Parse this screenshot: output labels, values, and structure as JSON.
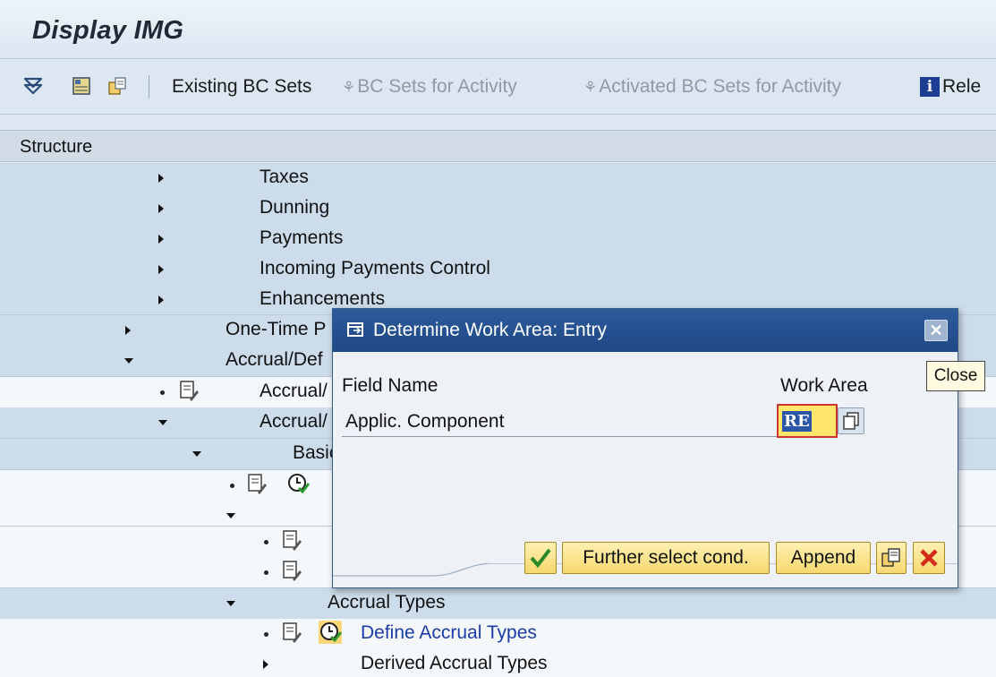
{
  "window": {
    "title": "Display IMG"
  },
  "toolbar": {
    "existing_bc_sets": "Existing BC Sets",
    "bc_sets_for_activity": "BC Sets for Activity",
    "activated_bc_sets": "Activated BC Sets for Activity",
    "release_notes_partial": "Rele"
  },
  "structure": {
    "header": "Structure",
    "rows": {
      "taxes": "Taxes",
      "dunning": "Dunning",
      "payments": "Payments",
      "incoming_payments_control": "Incoming Payments Control",
      "enhancements": "Enhancements",
      "one_time": "One-Time P",
      "accrual_def": "Accrual/Def",
      "accrual_a": "Accrual/",
      "accrual_b": "Accrual/",
      "basic": "Basic",
      "accrual_types": "Accrual Types",
      "define_accrual_types": "Define Accrual Types",
      "derived_accrual_types": "Derived Accrual Types"
    }
  },
  "dialog": {
    "title": "Determine Work Area: Entry",
    "field_name_header": "Field Name",
    "work_area_header": "Work Area",
    "field_label": "Applic. Component",
    "work_area_value": "RE",
    "further_select": "Further select cond.",
    "append": "Append"
  },
  "tooltip": {
    "text": "Close"
  },
  "colors": {
    "dialog_title_bg": "#2e5b9c",
    "button_bg": "#f5d86e",
    "link": "#1a3ca6"
  }
}
